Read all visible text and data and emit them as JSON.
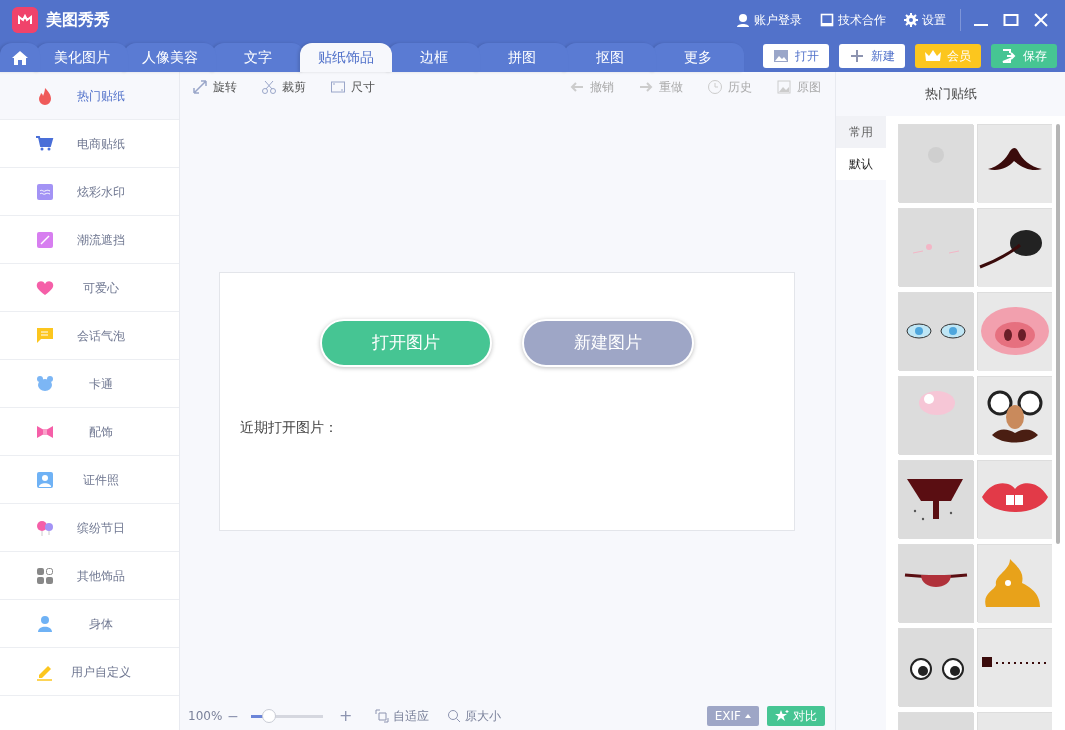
{
  "app": {
    "title": "美图秀秀"
  },
  "header_links": [
    "账户登录",
    "技术合作",
    "设置"
  ],
  "tabs": [
    {
      "kind": "home",
      "selected": false
    },
    {
      "label": "美化图片",
      "selected": false
    },
    {
      "label": "人像美容",
      "selected": false
    },
    {
      "label": "文字",
      "selected": false
    },
    {
      "label": "贴纸饰品",
      "selected": true
    },
    {
      "label": "边框",
      "selected": false
    },
    {
      "label": "拼图",
      "selected": false
    },
    {
      "label": "抠图",
      "selected": false
    },
    {
      "label": "更多",
      "selected": false
    }
  ],
  "actions": [
    {
      "label": "打开",
      "kind": "open"
    },
    {
      "label": "新建",
      "kind": "new"
    },
    {
      "label": "会员",
      "kind": "vip"
    },
    {
      "label": "保存",
      "kind": "save"
    }
  ],
  "sidebar": {
    "items": [
      {
        "label": "热门贴纸",
        "selected": true
      },
      {
        "label": "电商贴纸",
        "selected": false
      },
      {
        "label": "炫彩水印",
        "selected": false
      },
      {
        "label": "潮流遮挡",
        "selected": false
      },
      {
        "label": "可爱心",
        "selected": false
      },
      {
        "label": "会话气泡",
        "selected": false
      },
      {
        "label": "卡通",
        "selected": false
      },
      {
        "label": "配饰",
        "selected": false
      },
      {
        "label": "证件照",
        "selected": false
      },
      {
        "label": "缤纷节日",
        "selected": false
      },
      {
        "label": "其他饰品",
        "selected": false
      },
      {
        "label": "身体",
        "selected": false
      },
      {
        "label": "用户自定义",
        "selected": false
      }
    ]
  },
  "toolbar": [
    {
      "label": "旋转",
      "disabled": false
    },
    {
      "label": "裁剪",
      "disabled": false
    },
    {
      "label": "尺寸",
      "disabled": false
    },
    {
      "label": "撤销",
      "disabled": true
    },
    {
      "label": "重做",
      "disabled": true
    },
    {
      "label": "历史",
      "disabled": true
    },
    {
      "label": "原图",
      "disabled": true
    }
  ],
  "start": {
    "open_button": "打开图片",
    "new_button": "新建图片",
    "recent_label": "近期打开图片："
  },
  "bottom": {
    "zoom": "100%",
    "minus": "−",
    "plus": "+",
    "level": 0.25,
    "fit": "自适应",
    "actual": "原大小",
    "exif": "EXIF",
    "compare": "对比"
  },
  "panel": {
    "title": "热门贴纸",
    "tabs": [
      {
        "label": "常用",
        "selected": false
      },
      {
        "label": "默认",
        "selected": true
      }
    ]
  }
}
